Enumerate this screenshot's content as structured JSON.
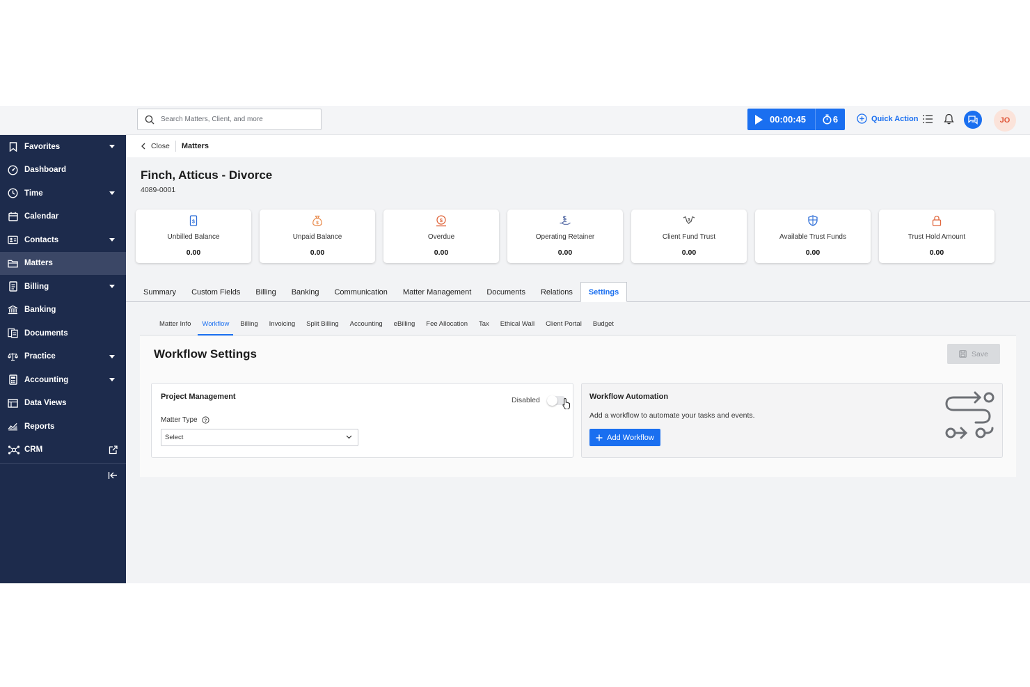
{
  "search": {
    "placeholder": "Search Matters, Client, and more"
  },
  "timer": {
    "time": "00:00:45",
    "count": "6"
  },
  "header": {
    "quick_action": "Quick Action",
    "avatar_initials": "JO"
  },
  "sidebar": {
    "items": [
      {
        "label": "Favorites",
        "icon": "bookmark-icon",
        "caret": true
      },
      {
        "label": "Dashboard",
        "icon": "dashboard-icon",
        "caret": false
      },
      {
        "label": "Time",
        "icon": "clock-icon",
        "caret": true
      },
      {
        "label": "Calendar",
        "icon": "calendar-icon",
        "caret": false
      },
      {
        "label": "Contacts",
        "icon": "contacts-icon",
        "caret": true
      },
      {
        "label": "Matters",
        "icon": "folder-icon",
        "caret": false,
        "active": true
      },
      {
        "label": "Billing",
        "icon": "billing-icon",
        "caret": true
      },
      {
        "label": "Banking",
        "icon": "bank-icon",
        "caret": false
      },
      {
        "label": "Documents",
        "icon": "documents-icon",
        "caret": false
      },
      {
        "label": "Practice",
        "icon": "scales-icon",
        "caret": true
      },
      {
        "label": "Accounting",
        "icon": "calculator-icon",
        "caret": true
      },
      {
        "label": "Data Views",
        "icon": "table-icon",
        "caret": false
      },
      {
        "label": "Reports",
        "icon": "reports-icon",
        "caret": false
      },
      {
        "label": "CRM",
        "icon": "crm-icon",
        "caret": false,
        "external": true
      }
    ]
  },
  "breadcrumb": {
    "close": "Close",
    "current": "Matters"
  },
  "matter": {
    "title": "Finch, Atticus - Divorce",
    "number": "4089-0001"
  },
  "cards": [
    {
      "label": "Unbilled Balance",
      "value": "0.00",
      "icon": "invoice-icon"
    },
    {
      "label": "Unpaid Balance",
      "value": "0.00",
      "icon": "money-bag-icon"
    },
    {
      "label": "Overdue",
      "value": "0.00",
      "icon": "overdue-icon"
    },
    {
      "label": "Operating Retainer",
      "value": "0.00",
      "icon": "hand-money-icon"
    },
    {
      "label": "Client Fund Trust",
      "value": "0.00",
      "icon": "handshake-icon"
    },
    {
      "label": "Available Trust Funds",
      "value": "0.00",
      "icon": "shield-icon"
    },
    {
      "label": "Trust Hold Amount",
      "value": "0.00",
      "icon": "lock-icon"
    }
  ],
  "tabs": [
    "Summary",
    "Custom Fields",
    "Billing",
    "Banking",
    "Communication",
    "Matter Management",
    "Documents",
    "Relations",
    "Settings"
  ],
  "active_tab": "Settings",
  "subtabs": [
    "Matter Info",
    "Workflow",
    "Billing",
    "Invoicing",
    "Split Billing",
    "Accounting",
    "eBilling",
    "Fee Allocation",
    "Tax",
    "Ethical Wall",
    "Client Portal",
    "Budget"
  ],
  "active_subtab": "Workflow",
  "workflow": {
    "title": "Workflow Settings",
    "save_label": "Save",
    "project_management": {
      "heading": "Project Management",
      "toggle_label": "Disabled",
      "toggle_on": false,
      "matter_type_label": "Matter Type",
      "matter_type_value": "Select"
    },
    "automation": {
      "heading": "Workflow Automation",
      "description": "Add a workflow to automate your tasks and events.",
      "button": "Add Workflow"
    }
  },
  "colors": {
    "accent": "#1a6ff0",
    "sidebar": "#1d2b4c",
    "card_icon": "#e8894a"
  }
}
